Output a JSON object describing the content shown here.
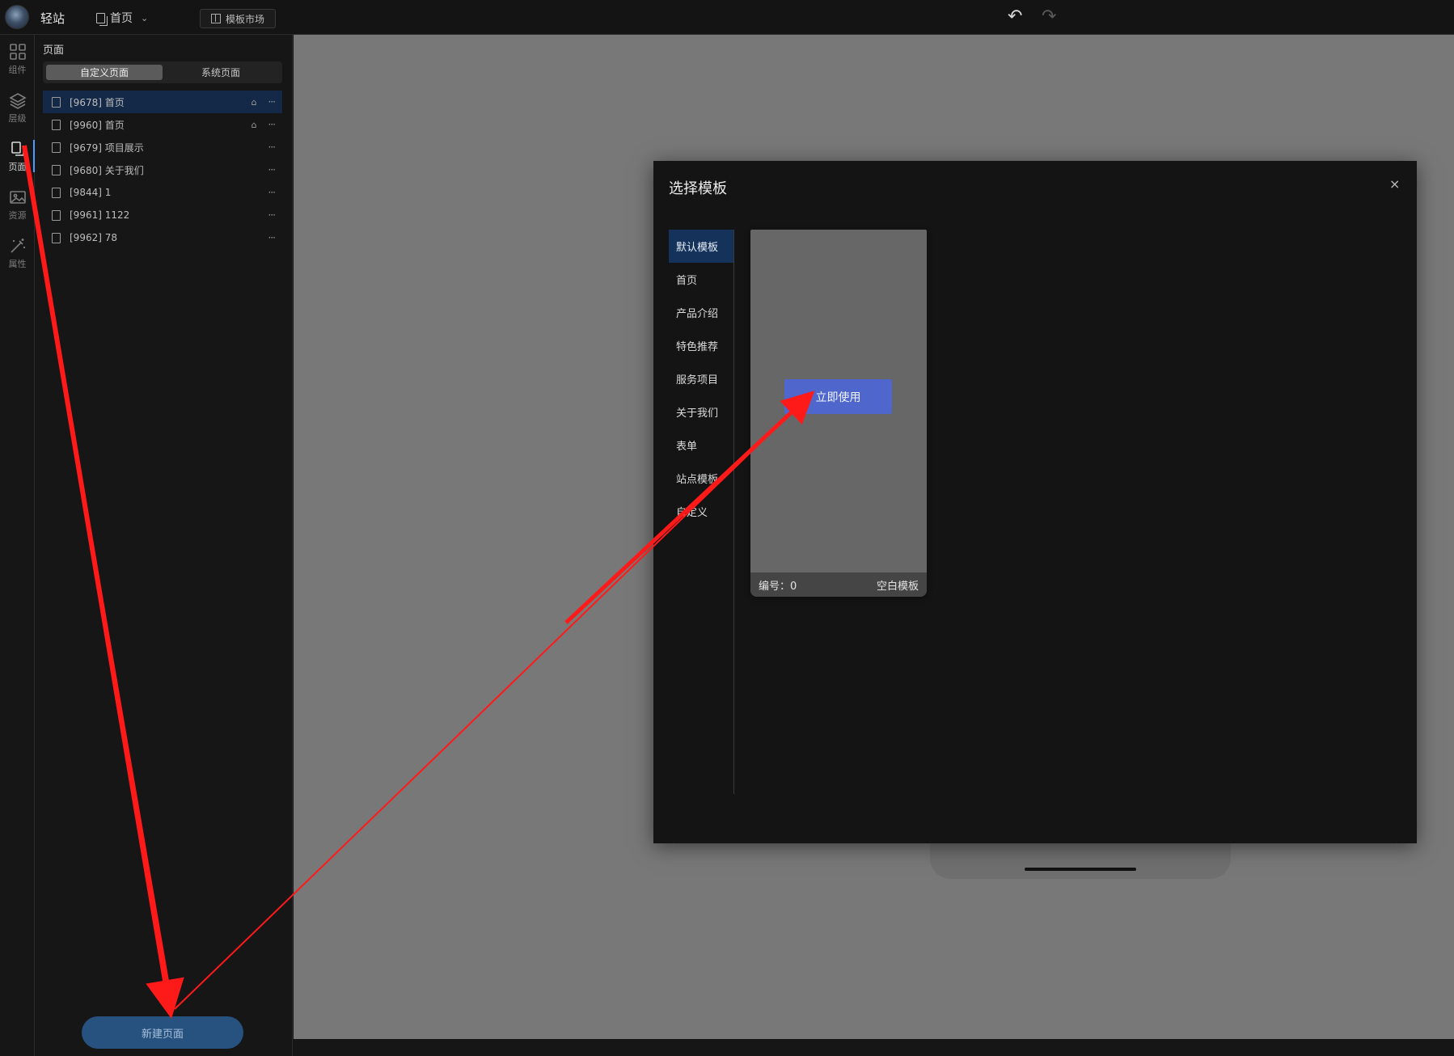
{
  "topbar": {
    "app_title": "轻站",
    "current_page": "首页",
    "market_label": "模板市场",
    "undo_icon": "undo-icon",
    "redo_icon": "redo-icon"
  },
  "rail": {
    "items": [
      {
        "label": "组件",
        "icon": "grid-icon"
      },
      {
        "label": "层级",
        "icon": "layers-icon"
      },
      {
        "label": "页面",
        "icon": "page-icon",
        "active": true
      },
      {
        "label": "资源",
        "icon": "image-icon"
      },
      {
        "label": "属性",
        "icon": "magic-wand-icon"
      }
    ]
  },
  "panel": {
    "title": "页面",
    "tabs": [
      "自定义页面",
      "系统页面"
    ],
    "active_tab": "自定义页面",
    "pages": [
      {
        "id": "[9678]",
        "name": "首页",
        "home": true,
        "active": true
      },
      {
        "id": "[9960]",
        "name": "首页",
        "home": true
      },
      {
        "id": "[9679]",
        "name": "项目展示"
      },
      {
        "id": "[9680]",
        "name": "关于我们"
      },
      {
        "id": "[9844]",
        "name": "1"
      },
      {
        "id": "[9961]",
        "name": "1122"
      },
      {
        "id": "[9962]",
        "name": "78"
      }
    ],
    "more_glyph": "···",
    "new_page_label": "新建页面"
  },
  "modal": {
    "title": "选择模板",
    "close": "×",
    "categories": [
      "默认模板",
      "首页",
      "产品介绍",
      "特色推荐",
      "服务项目",
      "关于我们",
      "表单",
      "站点模板",
      "自定义"
    ],
    "active_category": "默认模板",
    "template": {
      "use_label": "立即使用",
      "number_label": "编号：0",
      "name": "空白模板"
    }
  },
  "colors": {
    "accent": "#4f67cc",
    "selected_row": "#142848",
    "annotation_arrow": "#ff1a1a",
    "canvas": "#787878"
  }
}
